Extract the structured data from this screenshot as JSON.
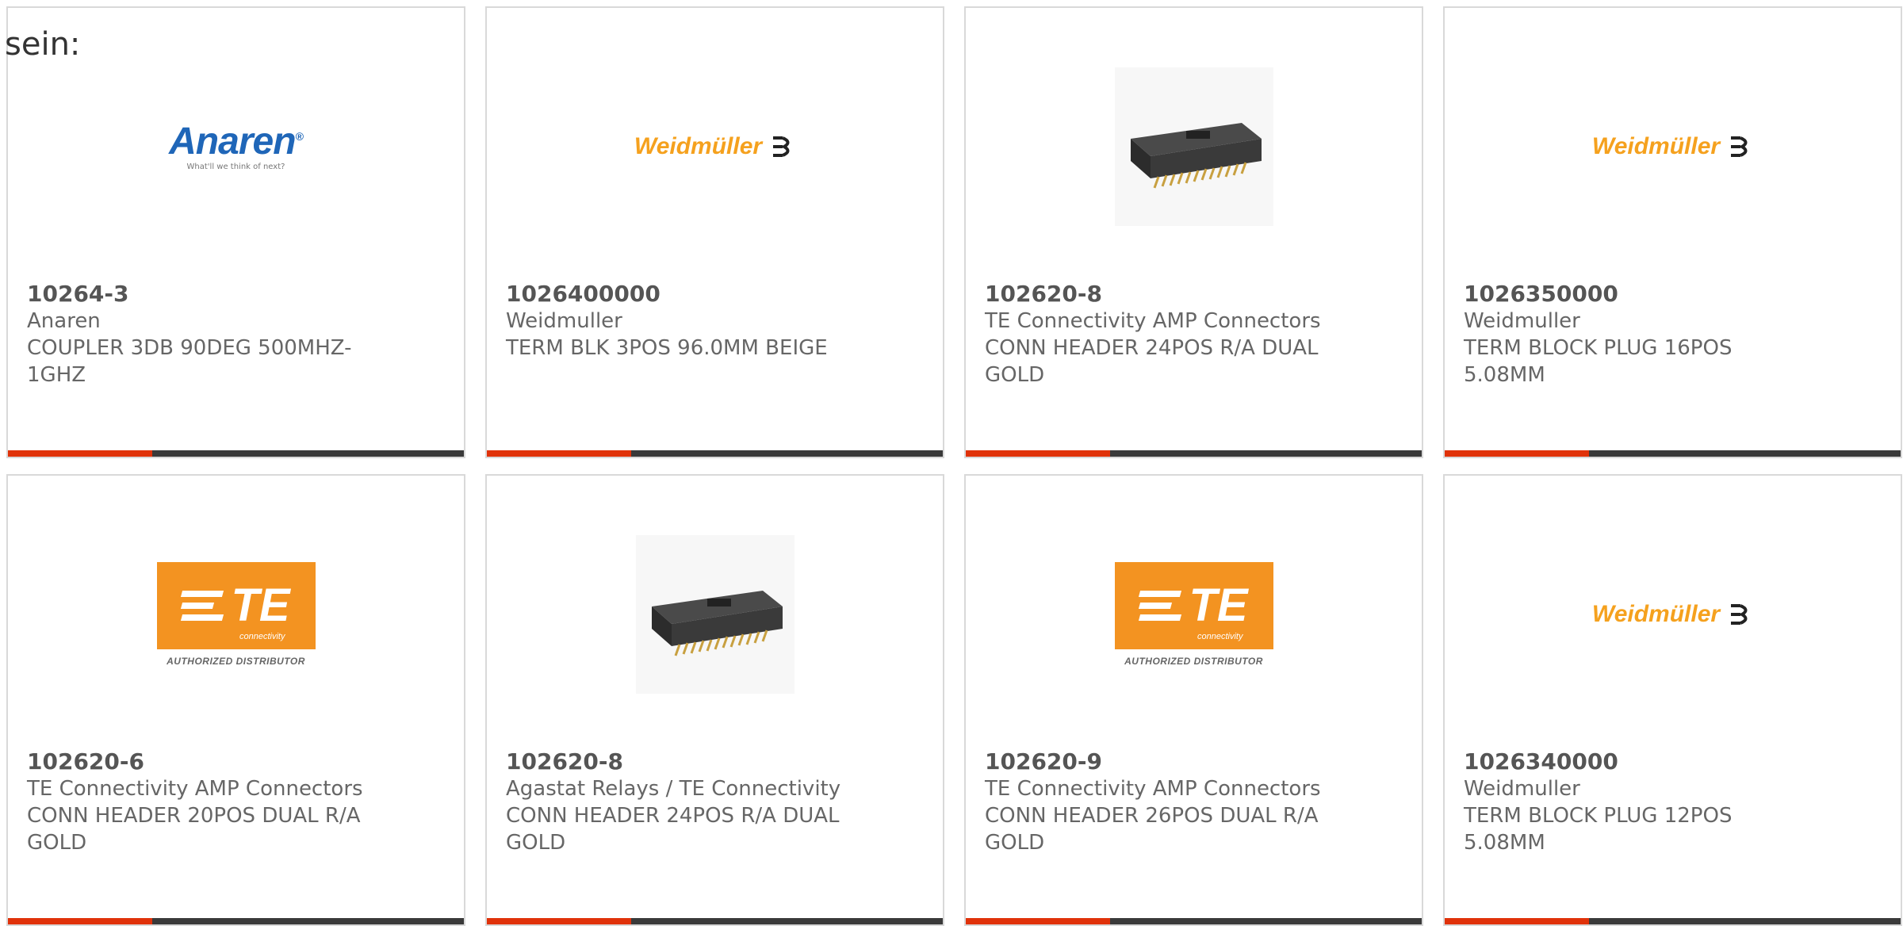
{
  "intro_text": "sein:",
  "colors": {
    "accent": "#e0320a",
    "bar": "#3a3a3a",
    "card_border": "#d9d9d9"
  },
  "products": [
    {
      "part_number": "10264-3",
      "manufacturer": "Anaren",
      "description_line1": "COUPLER 3DB 90DEG 500MHZ-",
      "description_line2": "1GHZ",
      "logo": {
        "type": "anaren",
        "name": "Anaren",
        "tagline": "What'll we think of next?"
      }
    },
    {
      "part_number": "1026400000",
      "manufacturer": "Weidmuller",
      "description_line1": "TERM BLK 3POS 96.0MM BEIGE",
      "description_line2": "",
      "logo": {
        "type": "weidmuller",
        "name": "Weidmüller"
      }
    },
    {
      "part_number": "102620-8",
      "manufacturer": "TE Connectivity AMP Connectors",
      "description_line1": "CONN HEADER 24POS R/A DUAL",
      "description_line2": "GOLD",
      "logo": {
        "type": "photo",
        "name": "connector-header-photo"
      }
    },
    {
      "part_number": "1026350000",
      "manufacturer": "Weidmuller",
      "description_line1": "TERM BLOCK PLUG 16POS",
      "description_line2": "5.08MM",
      "logo": {
        "type": "weidmuller",
        "name": "Weidmüller"
      }
    },
    {
      "part_number": "102620-6",
      "manufacturer": "TE Connectivity AMP Connectors",
      "description_line1": "CONN HEADER 20POS DUAL R/A",
      "description_line2": "GOLD",
      "logo": {
        "type": "te",
        "mark": "TE",
        "sub": "connectivity",
        "caption": "AUTHORIZED DISTRIBUTOR"
      }
    },
    {
      "part_number": "102620-8",
      "manufacturer": "Agastat Relays / TE Connectivity",
      "description_line1": "CONN HEADER 24POS R/A DUAL",
      "description_line2": "GOLD",
      "logo": {
        "type": "photo",
        "name": "connector-header-photo"
      }
    },
    {
      "part_number": "102620-9",
      "manufacturer": "TE Connectivity AMP Connectors",
      "description_line1": "CONN HEADER 26POS DUAL R/A",
      "description_line2": "GOLD",
      "logo": {
        "type": "te",
        "mark": "TE",
        "sub": "connectivity",
        "caption": "AUTHORIZED DISTRIBUTOR"
      }
    },
    {
      "part_number": "1026340000",
      "manufacturer": "Weidmuller",
      "description_line1": "TERM BLOCK PLUG 12POS",
      "description_line2": "5.08MM",
      "logo": {
        "type": "weidmuller",
        "name": "Weidmüller"
      }
    }
  ]
}
